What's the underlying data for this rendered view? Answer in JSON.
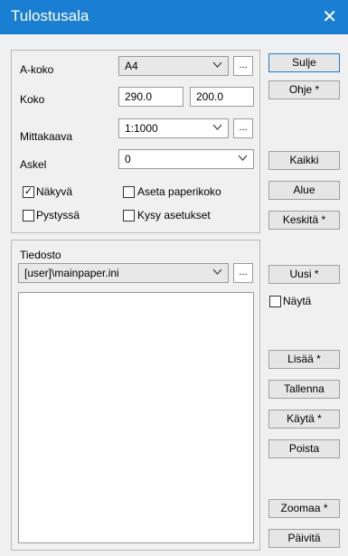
{
  "window": {
    "title": "Tulostusala",
    "close_glyph": "✕"
  },
  "settings": {
    "paper_size_label": "A-koko",
    "paper_size_value": "A4",
    "size_label": "Koko",
    "size_width": "290.0",
    "size_height": "200.0",
    "scale_label": "Mittakaava",
    "scale_value": "1:1000",
    "step_label": "Askel",
    "step_value": "0",
    "visible_label": "Näkyvä",
    "visible_checked": "✓",
    "portrait_label": "Pystyssä",
    "set_paper_size_label": "Aseta paperikoko",
    "ask_settings_label": "Kysy asetukset",
    "ellipsis": "..."
  },
  "file": {
    "label": "Tiedosto",
    "value": "[user]\\mainpaper.ini",
    "ellipsis": "..."
  },
  "buttons": {
    "close": "Sulje",
    "help": "Ohje *",
    "all": "Kaikki",
    "area": "Alue",
    "center": "Keskitä *",
    "new": "Uusi *",
    "show": "Näytä",
    "add": "Lisää *",
    "save": "Tallenna",
    "use": "Käytä *",
    "delete": "Poista",
    "zoom": "Zoomaa *",
    "refresh": "Päivitä"
  },
  "icons": {
    "chevron": "chevron-down-icon",
    "close": "close-icon"
  }
}
